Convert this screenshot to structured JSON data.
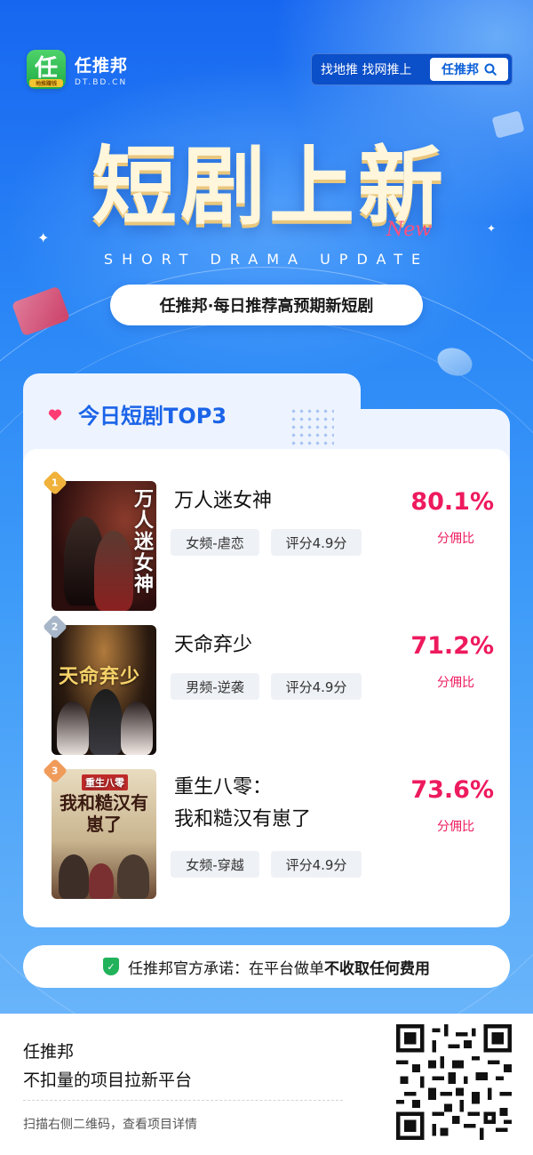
{
  "brand": {
    "name": "任推邦",
    "url": "DT.BD.CN",
    "badge_char": "任",
    "badge_sub": "地推赚钱"
  },
  "search": {
    "placeholder": "找地推 找网推上",
    "button_label": "任推邦"
  },
  "hero": {
    "title": "短剧上新",
    "script": "New",
    "subtitle_en": "SHORT DRAMA UPDATE",
    "slogan": "任推邦·每日推荐高预期新短剧"
  },
  "card": {
    "heading": "今日短剧TOP3",
    "dramas": [
      {
        "rank": "1",
        "title_line1": "万人迷女神",
        "title_line2": "",
        "poster_text": "万人迷女神",
        "tag_genre": "女频-虐恋",
        "tag_score": "评分4.9分",
        "percent": "80.1%",
        "percent_label": "分佣比"
      },
      {
        "rank": "2",
        "title_line1": "天命弃少",
        "title_line2": "",
        "poster_text": "天命弃少",
        "tag_genre": "男频-逆袭",
        "tag_score": "评分4.9分",
        "percent": "71.2%",
        "percent_label": "分佣比"
      },
      {
        "rank": "3",
        "title_line1": "重生八零：",
        "title_line2": "我和糙汉有崽了",
        "poster_text_top": "重生八零",
        "poster_text": "我和糙汉有崽了",
        "tag_genre": "女频-穿越",
        "tag_score": "评分4.9分",
        "percent": "73.6%",
        "percent_label": "分佣比"
      }
    ]
  },
  "promise": {
    "prefix": "任推邦官方承诺：在平台做单",
    "bold": "不收取任何费用"
  },
  "footer": {
    "name": "任推邦",
    "desc": "不扣量的项目拉新平台",
    "hint": "扫描右侧二维码，查看项目详情"
  },
  "colors": {
    "primary_blue": "#1b64e8",
    "accent_pink": "#ee1a5e",
    "badge_green": "#21b25a",
    "rank1": "#f0b23a",
    "rank2": "#a7b6c8",
    "rank3": "#f09b5a"
  },
  "icons": [
    "search-icon",
    "heart-icon",
    "shield-check-icon",
    "qr-code-icon",
    "sparkle-icon"
  ]
}
